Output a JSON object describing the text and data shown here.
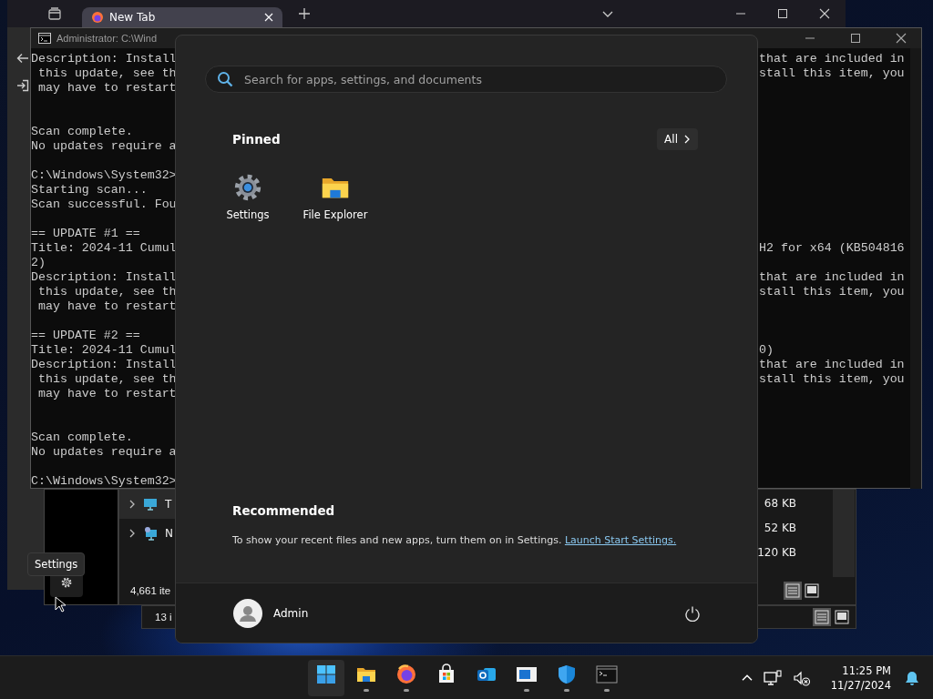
{
  "browser": {
    "tabs": [
      {
        "label": "New Tab",
        "selected": true
      }
    ]
  },
  "terminal": {
    "title": "Administrator: C:\\Wind",
    "lines": [
      {
        "left": "Description: Install",
        "right": "that are included in"
      },
      {
        "left": " this update, see th",
        "right": "stall this item, you"
      },
      {
        "left": " may have to restart"
      },
      {
        "kind": "blank"
      },
      {
        "kind": "blank"
      },
      {
        "left": "Scan complete."
      },
      {
        "left": "No updates require a"
      },
      {
        "kind": "blank"
      },
      {
        "left": "C:\\Windows\\System32>"
      },
      {
        "left": "Starting scan..."
      },
      {
        "left": "Scan successful. Fou"
      },
      {
        "kind": "blank"
      },
      {
        "left": "== UPDATE #1 =="
      },
      {
        "left": "Title: 2024-11 Cumul",
        "right": "H2 for x64 (KB504816"
      },
      {
        "left": "2)"
      },
      {
        "left": "Description: Install",
        "right": "that are included in"
      },
      {
        "left": " this update, see th",
        "right": "stall this item, you"
      },
      {
        "left": " may have to restart"
      },
      {
        "kind": "blank"
      },
      {
        "left": "== UPDATE #2 =="
      },
      {
        "left": "Title: 2024-11 Cumul",
        "right": "0)"
      },
      {
        "left": "Description: Install",
        "right": "that are included in"
      },
      {
        "left": " this update, see th",
        "right": "stall this item, you"
      },
      {
        "left": " may have to restart"
      },
      {
        "kind": "blank"
      },
      {
        "kind": "blank"
      },
      {
        "left": "Scan complete."
      },
      {
        "left": "No updates require a"
      },
      {
        "kind": "blank"
      },
      {
        "left": "C:\\Windows\\System32>"
      }
    ]
  },
  "explorer": {
    "tree_items": [
      {
        "label": "T",
        "kind": "monitor",
        "selected": true
      },
      {
        "label": "N",
        "kind": "network",
        "selected": false
      }
    ],
    "sizes": [
      "68 KB",
      "52 KB",
      "120 KB"
    ],
    "status": "4,661 ite",
    "views": [
      {
        "kind": "details",
        "selected": true
      },
      {
        "kind": "tiles",
        "selected": false
      }
    ]
  },
  "explorer_2": {
    "status": "13 i",
    "views": [
      {
        "kind": "details",
        "selected": true
      },
      {
        "kind": "tiles",
        "selected": false
      }
    ]
  },
  "tooltip": {
    "text": "Settings"
  },
  "start": {
    "search": {
      "placeholder": "Search for apps, settings, and documents"
    },
    "pinned_title": "Pinned",
    "all_button": "All",
    "pinned": [
      {
        "label": "Settings",
        "kind": "settings"
      },
      {
        "label": "File Explorer",
        "kind": "folder"
      }
    ],
    "recommended_title": "Recommended",
    "recommended_text": "To show your recent files and new apps, turn them on in Settings.",
    "recommended_link": "Launch Start Settings.",
    "user": "Admin"
  },
  "taskbar": {
    "apps": [
      {
        "kind": "start",
        "active": true,
        "running": false
      },
      {
        "kind": "folder",
        "active": false,
        "running": true
      },
      {
        "kind": "firefox",
        "active": false,
        "running": true
      },
      {
        "kind": "store",
        "active": false,
        "running": false
      },
      {
        "kind": "mail",
        "active": false,
        "running": false
      },
      {
        "kind": "window",
        "active": false,
        "running": true
      },
      {
        "kind": "shield",
        "active": false,
        "running": true
      },
      {
        "kind": "terminal",
        "active": false,
        "running": true
      }
    ],
    "clock": {
      "time": "11:25 PM",
      "date": "11/27/2024"
    }
  }
}
